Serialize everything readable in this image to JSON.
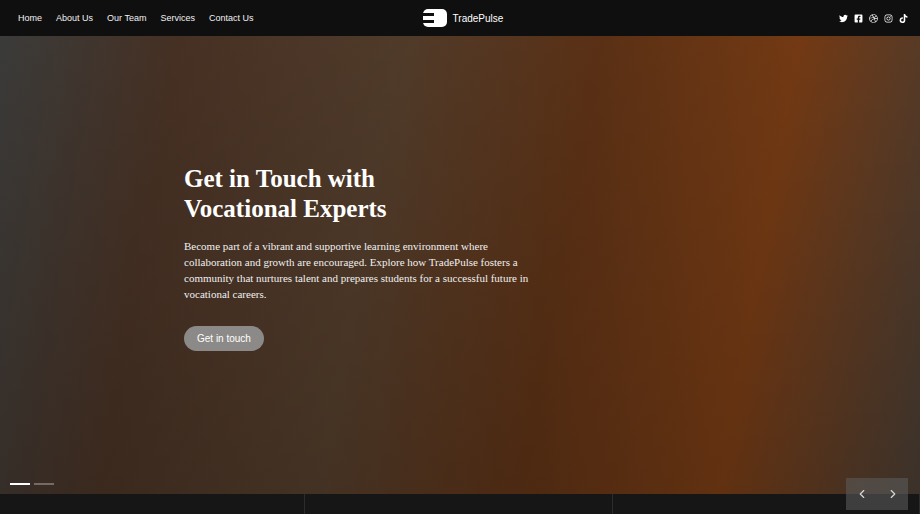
{
  "nav": {
    "links": [
      "Home",
      "About Us",
      "Our Team",
      "Services",
      "Contact Us"
    ],
    "brand": "TradePulse"
  },
  "hero": {
    "title": "Get in Touch with Vocational Experts",
    "text": "Become part of a vibrant and supportive learning environment where collaboration and growth are encouraged. Explore how TradePulse fosters a community that nurtures talent and prepares students for a successful future in vocational careers.",
    "button": "Get in touch"
  },
  "slides": [
    {
      "selected": true
    },
    {
      "selected": false
    }
  ]
}
